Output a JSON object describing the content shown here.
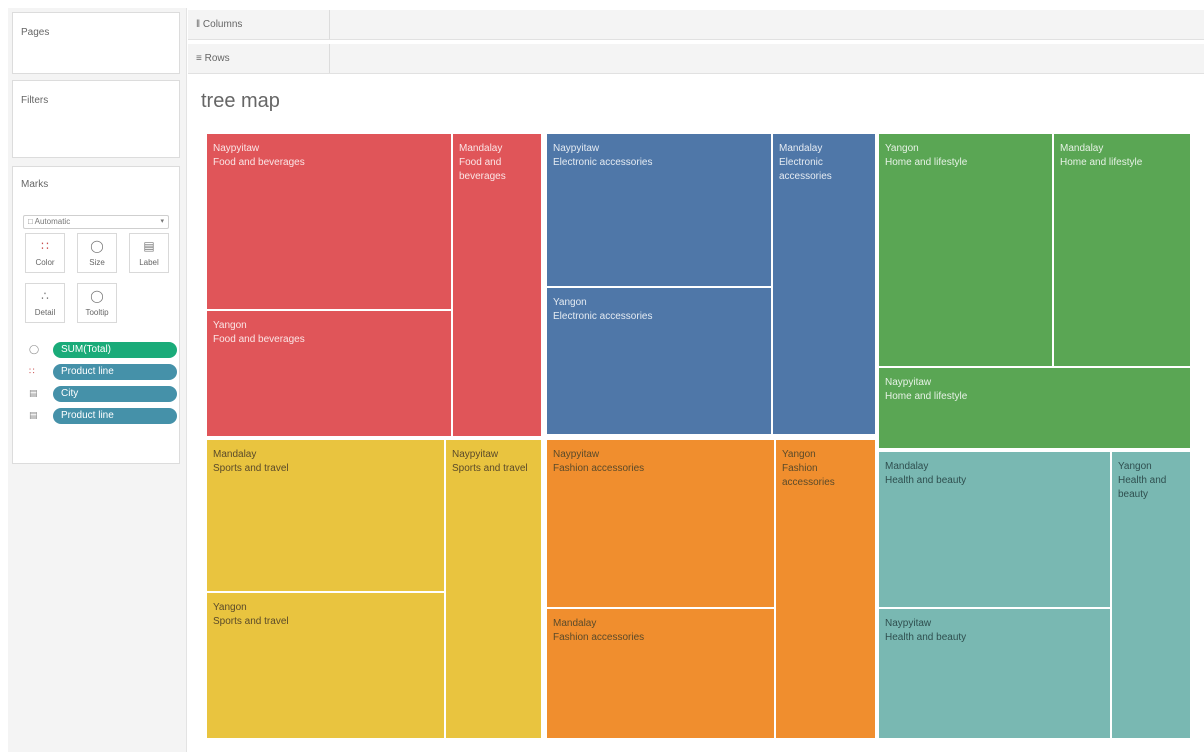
{
  "cards": {
    "pages": "Pages",
    "filters": "Filters",
    "marks": "Marks"
  },
  "marks": {
    "mark_type": "Automatic",
    "buttons": {
      "color": "Color",
      "size": "Size",
      "label": "Label",
      "detail": "Detail",
      "tooltip": "Tooltip"
    },
    "pills": [
      {
        "label": "SUM(Total)",
        "color": "#1aab79"
      },
      {
        "label": "Product line",
        "color": "#4591a9"
      },
      {
        "label": "City",
        "color": "#4591a9"
      },
      {
        "label": "Product line",
        "color": "#4591a9"
      }
    ]
  },
  "shelves": {
    "columns": "Columns",
    "rows": "Rows"
  },
  "viz": {
    "title": "tree map"
  },
  "tiles": [
    {
      "city": "Naypyitaw",
      "product": "Food and beverages",
      "color": "#e05559"
    },
    {
      "city": "Mandalay",
      "product": "Food and beverages",
      "color": "#e05559"
    },
    {
      "city": "Yangon",
      "product": "Food and beverages",
      "color": "#e05559"
    },
    {
      "city": "Naypyitaw",
      "product": "Electronic accessories",
      "color": "#4f77a8"
    },
    {
      "city": "Mandalay",
      "product": "Electronic accessories",
      "color": "#4f77a8"
    },
    {
      "city": "Yangon",
      "product": "Electronic accessories",
      "color": "#4f77a8"
    },
    {
      "city": "Yangon",
      "product": "Home and lifestyle",
      "color": "#5aa654"
    },
    {
      "city": "Mandalay",
      "product": "Home and lifestyle",
      "color": "#5aa654"
    },
    {
      "city": "Naypyitaw",
      "product": "Home and lifestyle",
      "color": "#5aa654"
    },
    {
      "city": "Mandalay",
      "product": "Sports and travel",
      "color": "#e9c43f"
    },
    {
      "city": "Naypyitaw",
      "product": "Sports and travel",
      "color": "#e9c43f"
    },
    {
      "city": "Yangon",
      "product": "Sports and travel",
      "color": "#e9c43f"
    },
    {
      "city": "Naypyitaw",
      "product": "Fashion accessories",
      "color": "#f08e2e"
    },
    {
      "city": "Yangon",
      "product": "Fashion accessories",
      "color": "#f08e2e"
    },
    {
      "city": "Mandalay",
      "product": "Fashion accessories",
      "color": "#f08e2e"
    },
    {
      "city": "Mandalay",
      "product": "Health and beauty",
      "color": "#79b8b2"
    },
    {
      "city": "Yangon",
      "product": "Health and beauty",
      "color": "#79b8b2"
    },
    {
      "city": "Naypyitaw",
      "product": "Health and beauty",
      "color": "#79b8b2"
    }
  ]
}
